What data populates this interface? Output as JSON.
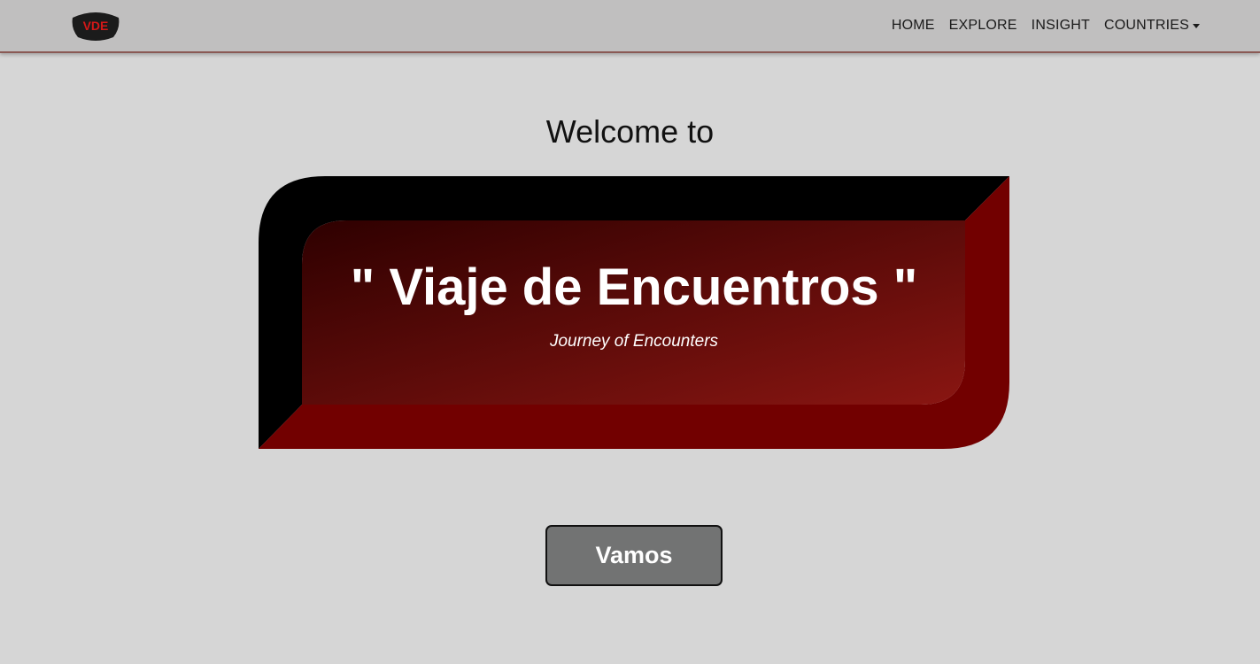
{
  "navbar": {
    "logo_text": "VDE",
    "links": [
      {
        "label": "HOME"
      },
      {
        "label": "EXPLORE"
      },
      {
        "label": "INSIGHT"
      },
      {
        "label": "COUNTRIES"
      }
    ]
  },
  "hero": {
    "welcome": "Welcome to",
    "title": "\" Viaje de Encuentros \"",
    "subtitle": "Journey of Encounters"
  },
  "cta": {
    "label": "Vamos"
  },
  "colors": {
    "page_background": "#d6d6d6",
    "navbar_background": "#c0bfbf",
    "bevel_dark": "#000000",
    "bevel_red": "#720000",
    "panel_gradient_start": "#2e0000",
    "panel_gradient_end": "#8a1612",
    "button_background": "#727373"
  }
}
